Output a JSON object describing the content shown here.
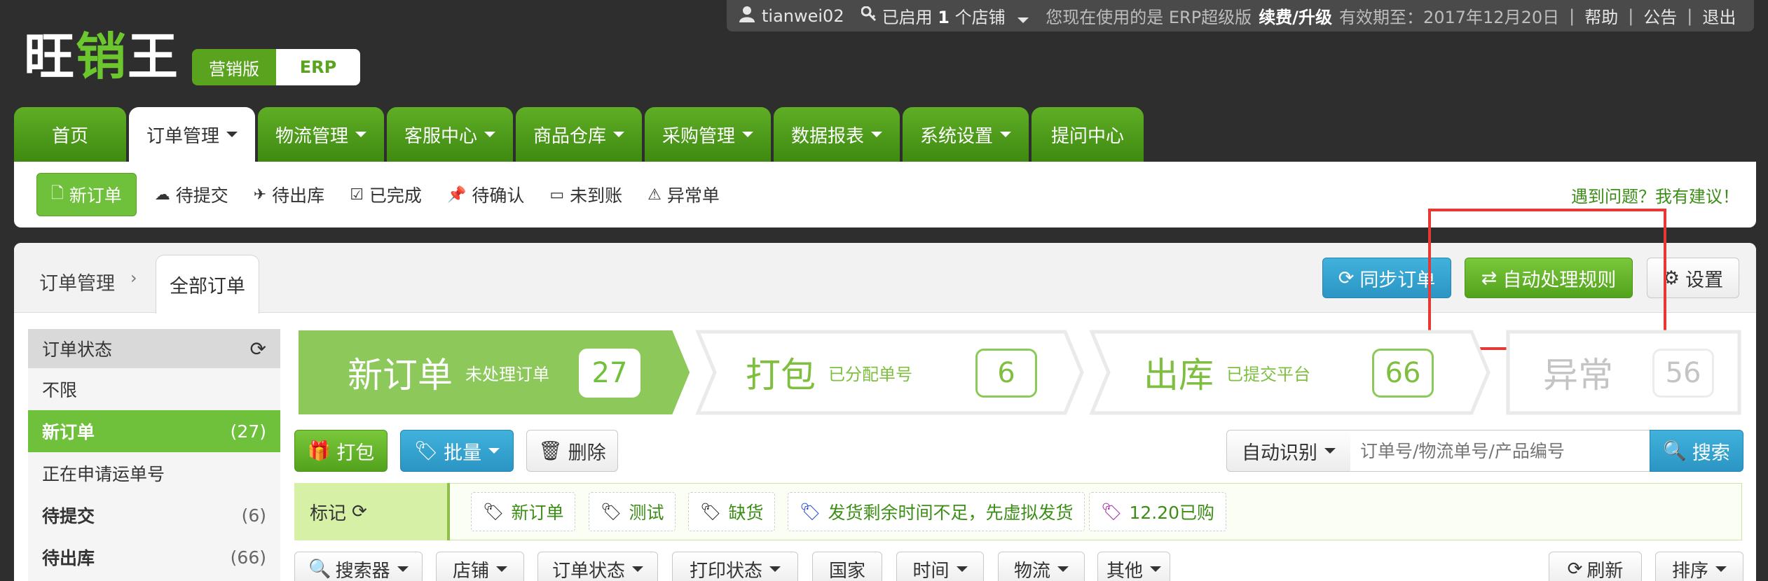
{
  "topbar": {
    "user_icon": "user-icon",
    "username": "tianwei02",
    "store_icon": "key-icon",
    "store_status": "已启用",
    "store_count": "1",
    "store_unit": "个店铺",
    "erp_notice": "您现在使用的是 ERP超级版",
    "renew": "续费/升级",
    "expiry_label": "有效期至：",
    "expiry_date": "2017年12月20日",
    "help": "帮助",
    "notice": "公告",
    "logout": "退出"
  },
  "logo": {
    "part1": "旺",
    "part2": "销",
    "part3": "王"
  },
  "edition": {
    "marketing": "营销版",
    "erp": "ERP"
  },
  "mainnav": [
    {
      "label": "首页",
      "dropdown": false,
      "active": false
    },
    {
      "label": "订单管理",
      "dropdown": true,
      "active": true
    },
    {
      "label": "物流管理",
      "dropdown": true,
      "active": false
    },
    {
      "label": "客服中心",
      "dropdown": true,
      "active": false
    },
    {
      "label": "商品仓库",
      "dropdown": true,
      "active": false
    },
    {
      "label": "采购管理",
      "dropdown": true,
      "active": false
    },
    {
      "label": "数据报表",
      "dropdown": true,
      "active": false
    },
    {
      "label": "系统设置",
      "dropdown": true,
      "active": false
    },
    {
      "label": "提问中心",
      "dropdown": false,
      "active": false
    }
  ],
  "subnav": {
    "items": [
      {
        "label": "新订单",
        "icon": "file-icon",
        "active": true
      },
      {
        "label": "待提交",
        "icon": "cloud-upload-icon",
        "active": false
      },
      {
        "label": "待出库",
        "icon": "plane-icon",
        "active": false
      },
      {
        "label": "已完成",
        "icon": "check-square-icon",
        "active": false
      },
      {
        "label": "待确认",
        "icon": "pin-icon",
        "active": false
      },
      {
        "label": "未到账",
        "icon": "credit-card-icon",
        "active": false
      },
      {
        "label": "异常单",
        "icon": "warning-icon",
        "active": false
      }
    ],
    "feedback": "遇到问题？我有建议！"
  },
  "breadcrumb": {
    "root": "订单管理",
    "current": "全部订单"
  },
  "actions": {
    "sync": "同步订单",
    "auto_rules": "自动处理规则",
    "settings": "设置"
  },
  "sidebar": {
    "title": "订单状态",
    "items": [
      {
        "label": "不限",
        "count": "",
        "bold": false,
        "active": false
      },
      {
        "label": "新订单",
        "count": "(27)",
        "bold": true,
        "active": true
      },
      {
        "label": "正在申请运单号",
        "count": "",
        "bold": false,
        "active": false
      },
      {
        "label": "待提交",
        "count": "(6)",
        "bold": true,
        "active": false
      },
      {
        "label": "待出库",
        "count": "(66)",
        "bold": true,
        "active": false
      }
    ]
  },
  "steps": {
    "new": {
      "title": "新订单",
      "sub": "未处理订单",
      "count": "27"
    },
    "pack": {
      "title": "打包",
      "sub": "已分配单号",
      "count": "6"
    },
    "ship": {
      "title": "出库",
      "sub": "已提交平台",
      "count": "66"
    },
    "error": {
      "title": "异常",
      "count": "56"
    }
  },
  "toolbar": {
    "pack": "打包",
    "batch": "批量",
    "delete": "删除",
    "auto_detect": "自动识别",
    "search_placeholder": "订单号/物流单号/产品编号",
    "search": "搜索"
  },
  "tags": {
    "label": "标记",
    "items": [
      {
        "label": "新订单",
        "color": "#222222"
      },
      {
        "label": "测试",
        "color": "#222222"
      },
      {
        "label": "缺货",
        "color": "#222222"
      },
      {
        "label": "发货剩余时间不足，先虚拟发货",
        "color": "#1a3fd9"
      },
      {
        "label": "12.20已购",
        "color": "#a01fa3"
      }
    ]
  },
  "filters": {
    "searcher": "搜索器",
    "store": "店铺",
    "order_status": "订单状态",
    "print_status": "打印状态",
    "country": "国家",
    "time": "时间",
    "logistics": "物流",
    "other": "其他",
    "refresh": "刷新",
    "sort": "排序"
  },
  "colors": {
    "primary_green": "#5aa31f",
    "accent_green": "#6fc03a",
    "blue": "#2b95c4",
    "highlight_red": "#e53935"
  }
}
